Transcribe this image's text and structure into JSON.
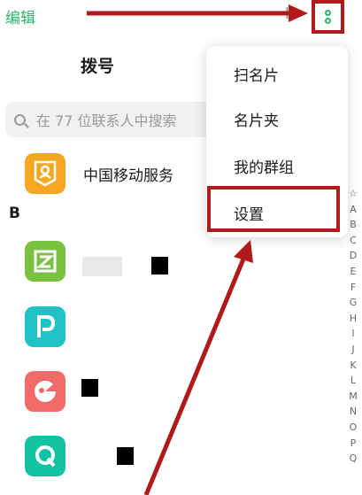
{
  "header": {
    "edit_label": "编辑",
    "plus_label": "+"
  },
  "tab_title": "拨号",
  "search": {
    "placeholder": "在 77 位联系人中搜索"
  },
  "contacts": [
    {
      "name": "中国移动服务"
    }
  ],
  "section_letter": "B",
  "menu": {
    "items": [
      "扫名片",
      "名片夹",
      "我的群组",
      "设置"
    ]
  },
  "alphabet": [
    "☆",
    "A",
    "B",
    "C",
    "D",
    "E",
    "F",
    "G",
    "H",
    "I",
    "J",
    "K",
    "L",
    "M",
    "N",
    "O",
    "P",
    "Q"
  ],
  "colors": {
    "accent_green": "#2fb56a",
    "annotation_red": "#b01a1a"
  },
  "icons": {
    "more": "more-vertical-icon",
    "search": "search-icon",
    "apps": [
      "china-mobile-service-icon",
      "app-z-icon",
      "app-p-icon",
      "app-game-icon",
      "app-q-icon"
    ]
  }
}
